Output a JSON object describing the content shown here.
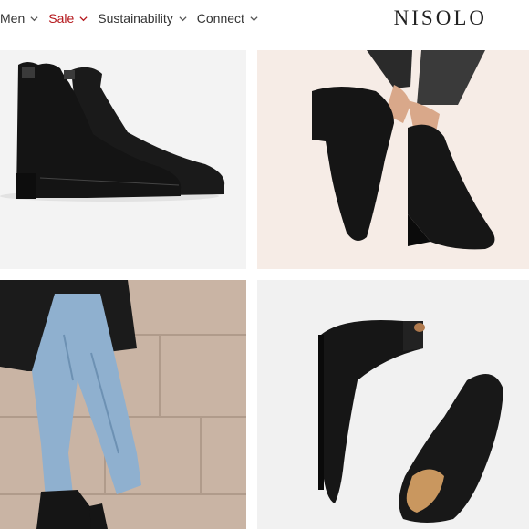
{
  "nav": {
    "items": [
      {
        "label": "Men",
        "icon": "chevron-down-icon"
      },
      {
        "label": "Sale",
        "icon": "chevron-down-icon",
        "color": "#b4161b"
      },
      {
        "label": "Sustainability",
        "icon": "chevron-down-icon"
      },
      {
        "label": "Connect",
        "icon": "chevron-down-icon"
      }
    ]
  },
  "brand": {
    "logo": "NISOLO"
  },
  "colors": {
    "accent": "#b4161b",
    "boot": "#141414"
  },
  "gallery": {
    "tiles": [
      {
        "name": "pair-of-black-chelsea-boots-side-view"
      },
      {
        "name": "model-wearing-black-chelsea-boots"
      },
      {
        "name": "model-in-jeans-and-blazer-street"
      },
      {
        "name": "black-chelsea-boots-top-view"
      }
    ]
  }
}
